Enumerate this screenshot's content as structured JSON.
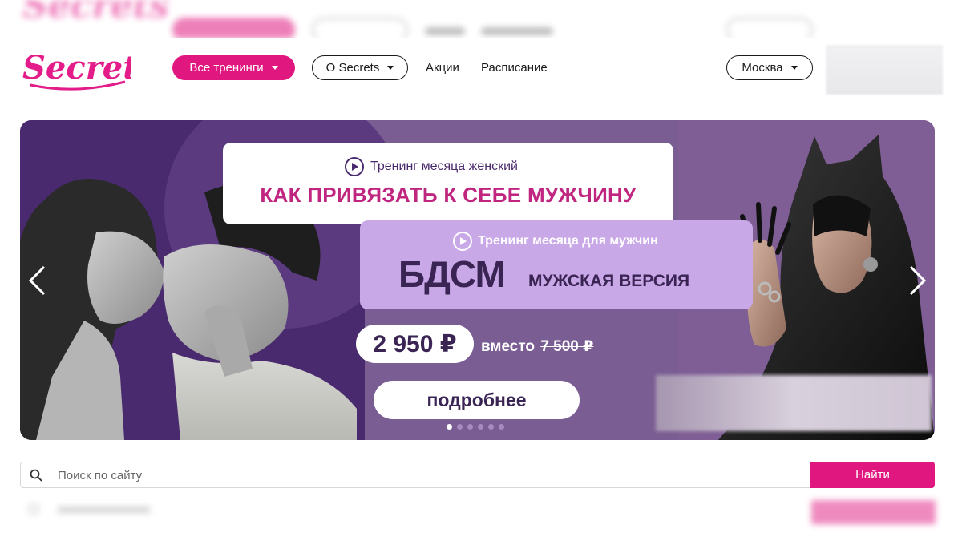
{
  "header": {
    "logo_text": "Secrets",
    "nav": {
      "all_trainings": "Все тренинги",
      "about": "O Secrets",
      "promos": "Акции",
      "schedule": "Расписание"
    },
    "city": "Москва"
  },
  "banner": {
    "women_training": {
      "subtitle": "Тренинг месяца женский",
      "title": "КАК ПРИВЯЗАТЬ К СЕБЕ МУЖЧИНУ"
    },
    "men_training": {
      "subtitle": "Тренинг месяца для мужчин",
      "big_title": "БДСМ",
      "small_title": "МУЖСКАЯ ВЕРСИЯ"
    },
    "price": "2 950 ₽",
    "instead_label": "вместо",
    "old_price": "7 500 ₽",
    "more_button": "подробнее",
    "slides_count": 6,
    "active_slide": 1
  },
  "search": {
    "placeholder": "Поиск по сайту",
    "button": "Найти"
  },
  "colors": {
    "brand_pink": "#e0177f",
    "banner_purple": "#7a5d93",
    "banner_dark": "#4a2a6e",
    "lilac": "#c9a8e8",
    "title_magenta": "#c0267f",
    "ink": "#3a2454"
  },
  "icons": [
    "play-icon",
    "chevron-left-icon",
    "chevron-right-icon",
    "search-icon",
    "caret-down-icon"
  ]
}
